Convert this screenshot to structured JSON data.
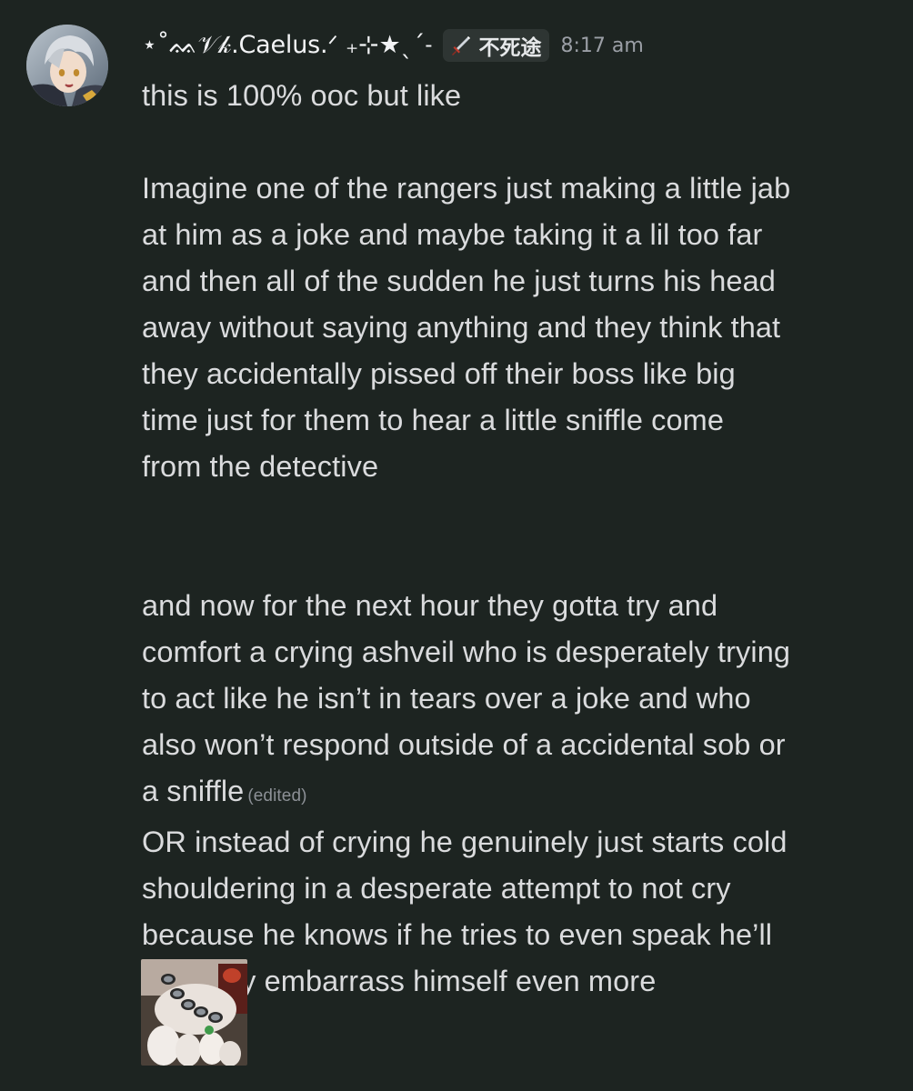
{
  "message": {
    "avatar_icon": "avatar-anime-character-silver-hair",
    "username": "⋆˚ᨐ𝒱𝓀.Caelus.ᐟ ₊⊹★ˎˊ˗",
    "tag": {
      "icon": "sword-icon",
      "text": "不死途"
    },
    "timestamp": "8:17 am",
    "lines_block1": [
      "this is 100% ooc but like"
    ],
    "lines_block2": [
      "Imagine one of the rangers just making a little jab",
      "at him as a joke and maybe taking it a lil too far",
      "and then all of the sudden he just turns his head",
      "away without saying anything and they think that",
      "they accidentally pissed off their boss like big",
      "time just for them to hear a little sniffle come",
      "from the detective"
    ],
    "lines_block3": [
      "and now for the next hour they gotta try and",
      "comfort a crying ashveil who is desperately trying",
      "to act like he isn’t in tears over a joke and who",
      "also won’t respond outside of a accidental sob or"
    ],
    "last_line": "a sniffle",
    "edited_label": "(edited)",
    "second_message_lines": [
      "OR instead of crying he genuinely just starts cold",
      "shouldering in a desperate attempt to not cry",
      "because he knows if he tries to even speak he’ll",
      "probably embarrass himself even more"
    ],
    "attachment_icon": "image-attachment-puppies-with-cups"
  },
  "colors": {
    "background": "#1d2421",
    "text": "#dadbdd",
    "muted": "#9b9fa6",
    "tag_bg": "#2e3533"
  }
}
